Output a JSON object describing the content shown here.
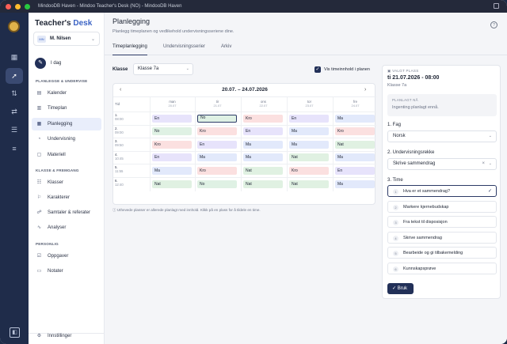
{
  "window": {
    "title": "MindooDB Haven - Mindoo Teacher's Desk (NO) - MindooDB Haven"
  },
  "brand": {
    "name": "Teacher's",
    "accent": "Desk"
  },
  "user": {
    "initials": "MN",
    "name": "M. Nilsen"
  },
  "sidebar": {
    "today": "I dag",
    "section1": "PLANLEGGE & UNDERVISE",
    "section2": "KLASSE & FREMGANG",
    "section3": "PERSONLIG",
    "items": [
      {
        "label": "Kalender",
        "icon": "calendar-icon"
      },
      {
        "label": "Timeplan",
        "icon": "schedule-icon"
      },
      {
        "label": "Planlegging",
        "icon": "planning-icon"
      },
      {
        "label": "Undervisning",
        "icon": "teaching-icon"
      },
      {
        "label": "Materiell",
        "icon": "material-icon"
      },
      {
        "label": "Klasser",
        "icon": "classes-icon"
      },
      {
        "label": "Karakterer",
        "icon": "grades-icon"
      },
      {
        "label": "Samtaler & referater",
        "icon": "meetings-icon"
      },
      {
        "label": "Analyser",
        "icon": "analytics-icon"
      },
      {
        "label": "Oppgaver",
        "icon": "tasks-icon"
      },
      {
        "label": "Notater",
        "icon": "notes-icon"
      },
      {
        "label": "Innstillinger",
        "icon": "settings-icon"
      }
    ]
  },
  "header": {
    "title": "Planlegging",
    "subtitle": "Planlegg timeplanen og vedlikehold undervisningsseriene dine."
  },
  "tabs": [
    "Timeplanlegging",
    "Undervisningsserier",
    "Arkiv"
  ],
  "filters": {
    "klasse_label": "Klasse",
    "klasse_value": "Klasse 7a",
    "show_content_label": "Vis timeinnhold i planen"
  },
  "calendar": {
    "range": "20.07. – 24.07.2026",
    "tid_label": "Tid",
    "days": [
      {
        "name": "man",
        "date": "20.07"
      },
      {
        "name": "tir",
        "date": "21.07"
      },
      {
        "name": "ons",
        "date": "22.07"
      },
      {
        "name": "tor",
        "date": "23.07"
      },
      {
        "name": "fre",
        "date": "24.07"
      }
    ],
    "rows": [
      {
        "num": "1.",
        "time": "08:00",
        "cells": [
          "En",
          "No",
          "Kro",
          "En",
          "Ma"
        ]
      },
      {
        "num": "2.",
        "time": "09:00",
        "cells": [
          "No",
          "Kro",
          "En",
          "Ma",
          "Kro"
        ]
      },
      {
        "num": "3.",
        "time": "09:50",
        "cells": [
          "Kro",
          "En",
          "Ma",
          "Ma",
          "Nat"
        ]
      },
      {
        "num": "4.",
        "time": "10:45",
        "cells": [
          "En",
          "Ma",
          "Ma",
          "Nat",
          "Ma"
        ]
      },
      {
        "num": "5.",
        "time": "11:55",
        "cells": [
          "Ma",
          "Kro",
          "Nat",
          "Kro",
          "En"
        ]
      },
      {
        "num": "6.",
        "time": "12:40",
        "cells": [
          "Nat",
          "No",
          "Nat",
          "Nat",
          "Ma"
        ]
      }
    ],
    "note": "Uthevede plasser er allerede planlagt med innhold. Klikk på en plass for å tildele en time."
  },
  "subject_colors": {
    "En": "#e7e3fb",
    "No": "#dff1e4",
    "Kro": "#fbe0e0",
    "Ma": "#e2e9fb",
    "Nat": "#e0f1e2"
  },
  "panel": {
    "selected_header": "VALGT PLASS",
    "datetime": "ti 21.07.2026 - 08:00",
    "klasse": "Klasse 7a",
    "planned_header": "PLANLAGT NÅ",
    "planned_value": "Ingenting planlagt ennå.",
    "fag_label": "1. Fag",
    "fag_value": "Norsk",
    "series_label": "2. Undervisningsrekke",
    "series_value": "Skrive sammendrag",
    "time_label": "3. Time",
    "times": [
      {
        "num": "1",
        "label": "Hva er et sammendrag?"
      },
      {
        "num": "2",
        "label": "Markere kjernebudskap"
      },
      {
        "num": "3",
        "label": "Fra tekst til disposisjon"
      },
      {
        "num": "4",
        "label": "Skrive sammendrag"
      },
      {
        "num": "5",
        "label": "Bearbeide og gi tilbakemelding"
      },
      {
        "num": "6",
        "label": "Kunnskapsprøve"
      }
    ],
    "use_button": "Bruk"
  }
}
